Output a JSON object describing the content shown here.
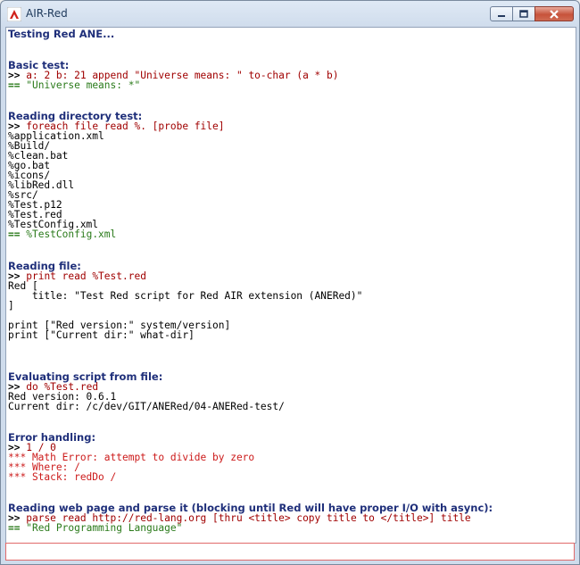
{
  "window": {
    "title": "AIR-Red",
    "controls": {
      "minimize": "minimize",
      "maximize": "maximize",
      "close": "close"
    }
  },
  "console": {
    "prompt": ">>",
    "result_arrow": "==",
    "header": "Testing Red ANE...",
    "basic": {
      "title": "Basic test:",
      "command": "a: 2 b: 21 append \"Universe means: \" to-char (a * b)",
      "result": "\"Universe means: *\""
    },
    "dir": {
      "title": "Reading directory test:",
      "command": "foreach file read %. [probe file]",
      "files": [
        "%application.xml",
        "%Build/",
        "%clean.bat",
        "%go.bat",
        "%icons/",
        "%libRed.dll",
        "%src/",
        "%Test.p12",
        "%Test.red",
        "%TestConfig.xml"
      ],
      "result": "%TestConfig.xml"
    },
    "readfile": {
      "title": "Reading file:",
      "command": "print read %Test.red",
      "lines": [
        "Red [",
        "    title: \"Test Red script for Red AIR extension (ANERed)\"",
        "]",
        "",
        "print [\"Red version:\" system/version]",
        "print [\"Current dir:\" what-dir]"
      ]
    },
    "evaluate": {
      "title": "Evaluating script from file:",
      "command": "do %Test.red",
      "lines": [
        "Red version: 0.6.1",
        "Current dir: /c/dev/GIT/ANERed/04-ANERed-test/"
      ]
    },
    "errors": {
      "title": "Error handling:",
      "command": "1 / 0",
      "lines": [
        "*** Math Error: attempt to divide by zero",
        "*** Where: /",
        "*** Stack: redDo /"
      ]
    },
    "web": {
      "title": "Reading web page and parse it (blocking until Red will have proper I/O with async):",
      "command": "parse read http://red-lang.org [thru <title> copy title to </title>] title",
      "result": "\"Red Programming Language\""
    }
  },
  "colors": {
    "heading": "#1f2f7a",
    "command": "#a00000",
    "result": "#2a7a1a",
    "error": "#cc1a1a"
  }
}
